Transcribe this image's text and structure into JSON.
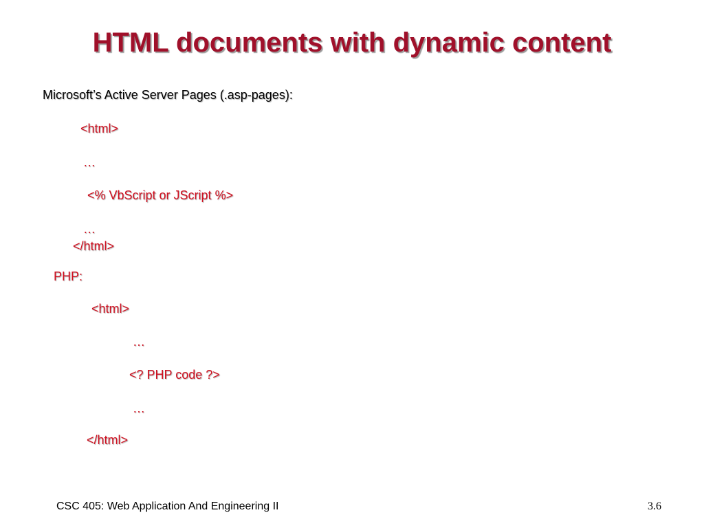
{
  "slide": {
    "title": "HTML documents with dynamic content",
    "asp_heading": "Microsoft’s Active Server Pages (.asp-pages):",
    "asp_lines": [
      "<html>",
      "…",
      "<% VbScript or JScript %>",
      "…",
      "</html>"
    ],
    "php_heading": "PHP:",
    "php_lines": [
      "<html>",
      "…",
      "<? PHP code ?>",
      "…",
      "</html>"
    ],
    "footer_left": "CSC 405: Web Application And Engineering II",
    "footer_right": "3.6"
  },
  "colors": {
    "title": "#a0102a",
    "code_text": "#d01020",
    "body_text": "#000000"
  }
}
